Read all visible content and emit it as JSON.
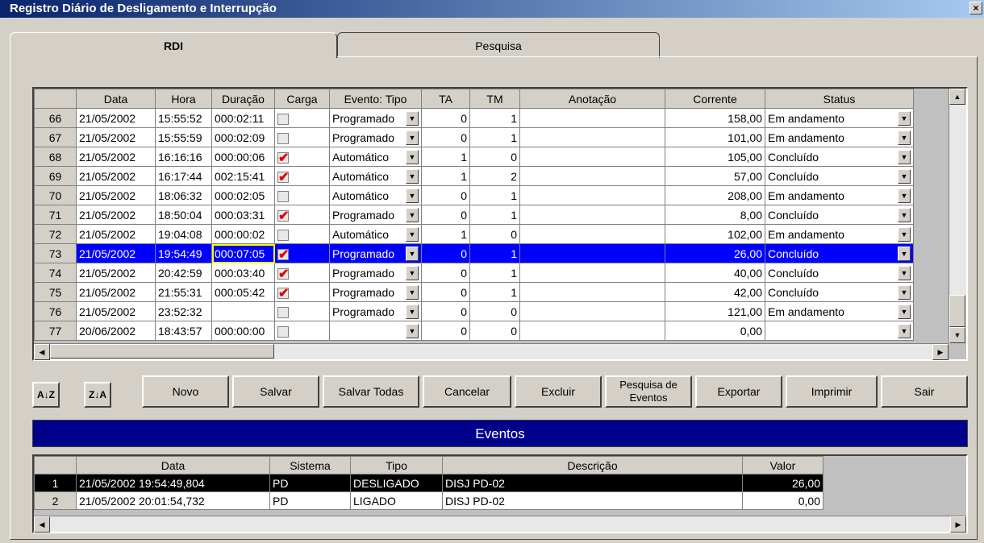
{
  "window": {
    "title": "Registro Diário de Desligamento e Interrupção",
    "close_label": "×"
  },
  "tabs": [
    {
      "label": "RDI"
    },
    {
      "label": "Pesquisa"
    }
  ],
  "grid": {
    "columns": [
      "Data",
      "Hora",
      "Duração",
      "Carga",
      "Evento: Tipo",
      "TA",
      "TM",
      "Anotação",
      "Corrente",
      "Status"
    ],
    "rows": [
      {
        "n": "66",
        "data": "21/05/2002",
        "hora": "15:55:52",
        "duracao": "000:02:11",
        "carga": false,
        "evento": "Programado",
        "ta": "0",
        "tm": "1",
        "anot": "",
        "corrente": "158,00",
        "status": "Em andamento"
      },
      {
        "n": "67",
        "data": "21/05/2002",
        "hora": "15:55:59",
        "duracao": "000:02:09",
        "carga": false,
        "evento": "Programado",
        "ta": "0",
        "tm": "1",
        "anot": "",
        "corrente": "101,00",
        "status": "Em andamento"
      },
      {
        "n": "68",
        "data": "21/05/2002",
        "hora": "16:16:16",
        "duracao": "000:00:06",
        "carga": true,
        "evento": "Automático",
        "ta": "1",
        "tm": "0",
        "anot": "",
        "corrente": "105,00",
        "status": "Concluído"
      },
      {
        "n": "69",
        "data": "21/05/2002",
        "hora": "16:17:44",
        "duracao": "002:15:41",
        "carga": true,
        "evento": "Automático",
        "ta": "1",
        "tm": "2",
        "anot": "",
        "corrente": "57,00",
        "status": "Concluído"
      },
      {
        "n": "70",
        "data": "21/05/2002",
        "hora": "18:06:32",
        "duracao": "000:02:05",
        "carga": false,
        "evento": "Automático",
        "ta": "0",
        "tm": "1",
        "anot": "",
        "corrente": "208,00",
        "status": "Em andamento"
      },
      {
        "n": "71",
        "data": "21/05/2002",
        "hora": "18:50:04",
        "duracao": "000:03:31",
        "carga": true,
        "evento": "Programado",
        "ta": "0",
        "tm": "1",
        "anot": "",
        "corrente": "8,00",
        "status": "Concluído"
      },
      {
        "n": "72",
        "data": "21/05/2002",
        "hora": "19:04:08",
        "duracao": "000:00:02",
        "carga": false,
        "evento": "Automático",
        "ta": "1",
        "tm": "0",
        "anot": "",
        "corrente": "102,00",
        "status": "Em andamento"
      },
      {
        "n": "73",
        "data": "21/05/2002",
        "hora": "19:54:49",
        "duracao": "000:07:05",
        "carga": true,
        "evento": "Programado",
        "ta": "0",
        "tm": "1",
        "anot": "",
        "corrente": "26,00",
        "status": "Concluído"
      },
      {
        "n": "74",
        "data": "21/05/2002",
        "hora": "20:42:59",
        "duracao": "000:03:40",
        "carga": true,
        "evento": "Programado",
        "ta": "0",
        "tm": "1",
        "anot": "",
        "corrente": "40,00",
        "status": "Concluído"
      },
      {
        "n": "75",
        "data": "21/05/2002",
        "hora": "21:55:31",
        "duracao": "000:05:42",
        "carga": true,
        "evento": "Programado",
        "ta": "0",
        "tm": "1",
        "anot": "",
        "corrente": "42,00",
        "status": "Concluído"
      },
      {
        "n": "76",
        "data": "21/05/2002",
        "hora": "23:52:32",
        "duracao": "",
        "carga": false,
        "evento": "Programado",
        "ta": "0",
        "tm": "0",
        "anot": "",
        "corrente": "121,00",
        "status": "Em andamento"
      },
      {
        "n": "77",
        "data": "20/06/2002",
        "hora": "18:43:57",
        "duracao": "000:00:00",
        "carga": false,
        "evento": "",
        "ta": "0",
        "tm": "0",
        "anot": "",
        "corrente": "0,00",
        "status": ""
      }
    ],
    "selected_row": "73"
  },
  "buttons": {
    "sort_asc": "A↓Z",
    "sort_desc": "Z↓A",
    "novo": "Novo",
    "salvar": "Salvar",
    "salvar_todas": "Salvar Todas",
    "cancelar": "Cancelar",
    "excluir": "Excluir",
    "pesquisa_eventos": "Pesquisa de Eventos",
    "exportar": "Exportar",
    "imprimir": "Imprimir",
    "sair": "Sair"
  },
  "eventos": {
    "title": "Eventos",
    "columns": [
      "Data",
      "Sistema",
      "Tipo",
      "Descrição",
      "Valor"
    ],
    "rows": [
      {
        "n": "1",
        "data": "21/05/2002 19:54:49,804",
        "sistema": "PD",
        "tipo": "DESLIGADO",
        "descricao": "DISJ PD-02",
        "valor": "26,00"
      },
      {
        "n": "2",
        "data": "21/05/2002 20:01:54,732",
        "sistema": "PD",
        "tipo": "LIGADO",
        "descricao": "DISJ PD-02",
        "valor": "0,00"
      }
    ]
  },
  "colors": {
    "selection": "#0000ff",
    "events_bar": "#00008b",
    "check": "#e00000"
  }
}
